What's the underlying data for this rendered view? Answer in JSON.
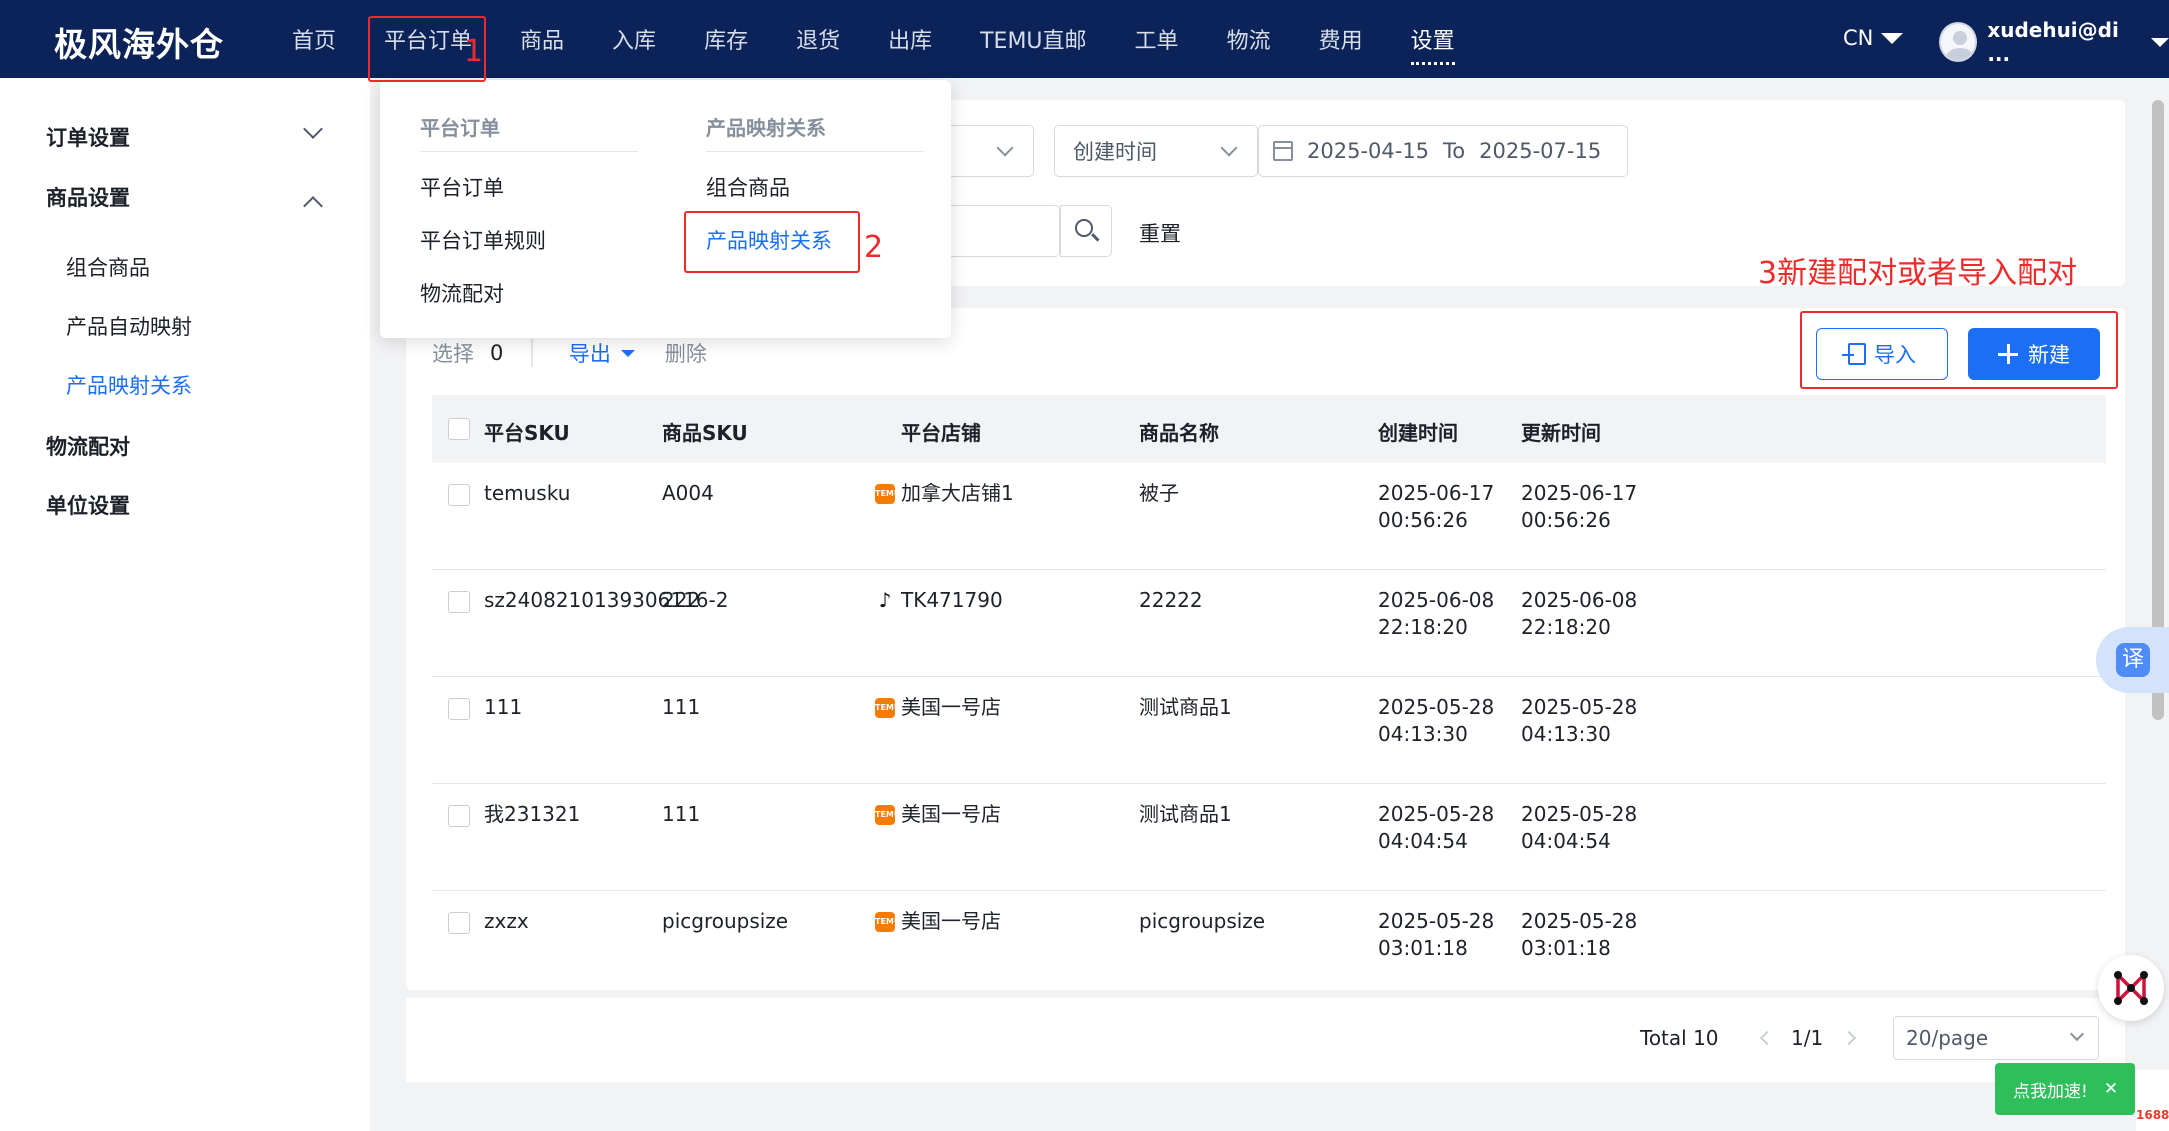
{
  "header": {
    "brand": "极风海外仓",
    "nav": [
      "首页",
      "平台订单",
      "商品",
      "入库",
      "库存",
      "退货",
      "出库",
      "TEMU直邮",
      "工单",
      "物流",
      "费用",
      "设置"
    ],
    "lang": "CN",
    "user": "xudehui@di ..."
  },
  "sidebar": {
    "group1": "订单设置",
    "group2": "商品设置",
    "sub1": "组合商品",
    "sub2": "产品自动映射",
    "sub3": "产品映射关系",
    "group3": "物流配对",
    "group4": "单位设置"
  },
  "filters": {
    "time_type": "创建时间",
    "date_from": "2025-04-15",
    "date_to_label": "To",
    "date_to": "2025-07-15",
    "reset": "重置"
  },
  "toolbar": {
    "select_label": "选择",
    "select_count": "0",
    "export": "导出",
    "delete": "删除",
    "import": "导入",
    "new": "新建"
  },
  "table": {
    "headers": [
      "平台SKU",
      "商品SKU",
      "平台店铺",
      "商品名称",
      "创建时间",
      "更新时间"
    ],
    "rows": [
      {
        "platform_sku": "temusku",
        "product_sku": "A004",
        "shop": "加拿大店铺1",
        "shop_icon": "temu-icon",
        "name": "被子",
        "created_date": "2025-06-17",
        "created_time": "00:56:26",
        "updated_date": "2025-06-17",
        "updated_time": "00:56:26"
      },
      {
        "platform_sku": "sz2408210139306116-2",
        "product_sku": "222",
        "shop": "TK471790",
        "shop_icon": "tiktok-icon",
        "name": "22222",
        "created_date": "2025-06-08",
        "created_time": "22:18:20",
        "updated_date": "2025-06-08",
        "updated_time": "22:18:20"
      },
      {
        "platform_sku": "111",
        "product_sku": "111",
        "shop": "美国一号店",
        "shop_icon": "temu-icon",
        "name": "测试商品1",
        "created_date": "2025-05-28",
        "created_time": "04:13:30",
        "updated_date": "2025-05-28",
        "updated_time": "04:13:30"
      },
      {
        "platform_sku": "我231321",
        "product_sku": "111",
        "shop": "美国一号店",
        "shop_icon": "temu-icon",
        "name": "测试商品1",
        "created_date": "2025-05-28",
        "created_time": "04:04:54",
        "updated_date": "2025-05-28",
        "updated_time": "04:04:54"
      },
      {
        "platform_sku": "zxzx",
        "product_sku": "picgroupsize",
        "shop": "美国一号店",
        "shop_icon": "temu-icon",
        "name": "picgroupsize",
        "created_date": "2025-05-28",
        "created_time": "03:01:18",
        "updated_date": "2025-05-28",
        "updated_time": "03:01:18"
      }
    ]
  },
  "pagination": {
    "total": "Total 10",
    "current": "1/1",
    "per_page": "20/page"
  },
  "dropdown": {
    "col1_head": "平台订单",
    "col1_items": [
      "平台订单",
      "平台订单规则",
      "物流配对"
    ],
    "col2_head": "产品映射关系",
    "col2_items": [
      "组合商品",
      "产品映射关系"
    ]
  },
  "annotations": {
    "n1": "1",
    "n2": "2",
    "n3": "3新建配对或者导入配对",
    "color": "#ee2b2b"
  },
  "widgets": {
    "translate": "译",
    "speed": "点我加速!",
    "close": "✕",
    "badge": "1688"
  },
  "colors": {
    "header_bg": "#0b2358",
    "accent": "#1a6ff5",
    "speed_green": "#2fbf5a"
  }
}
